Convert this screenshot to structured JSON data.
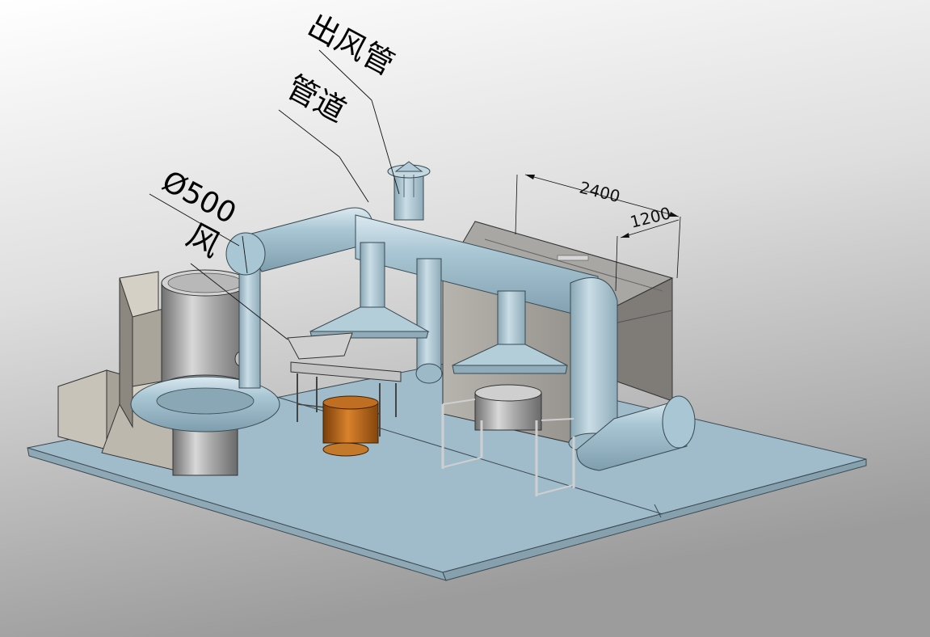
{
  "labels": {
    "outlet_duct": "出风管",
    "duct": "管道",
    "diameter": "Ø500",
    "wind_partial": "风"
  },
  "dimensions": {
    "length": "2400",
    "width": "1200"
  },
  "colors": {
    "background_top": "#ffffff",
    "background_bottom": "#9e9e9e",
    "floor": "#a0bccb",
    "duct": "#a9c6d4",
    "metal": "#9a9a9a",
    "cabinet": "#8c8a86",
    "bronze": "#b5631a"
  }
}
